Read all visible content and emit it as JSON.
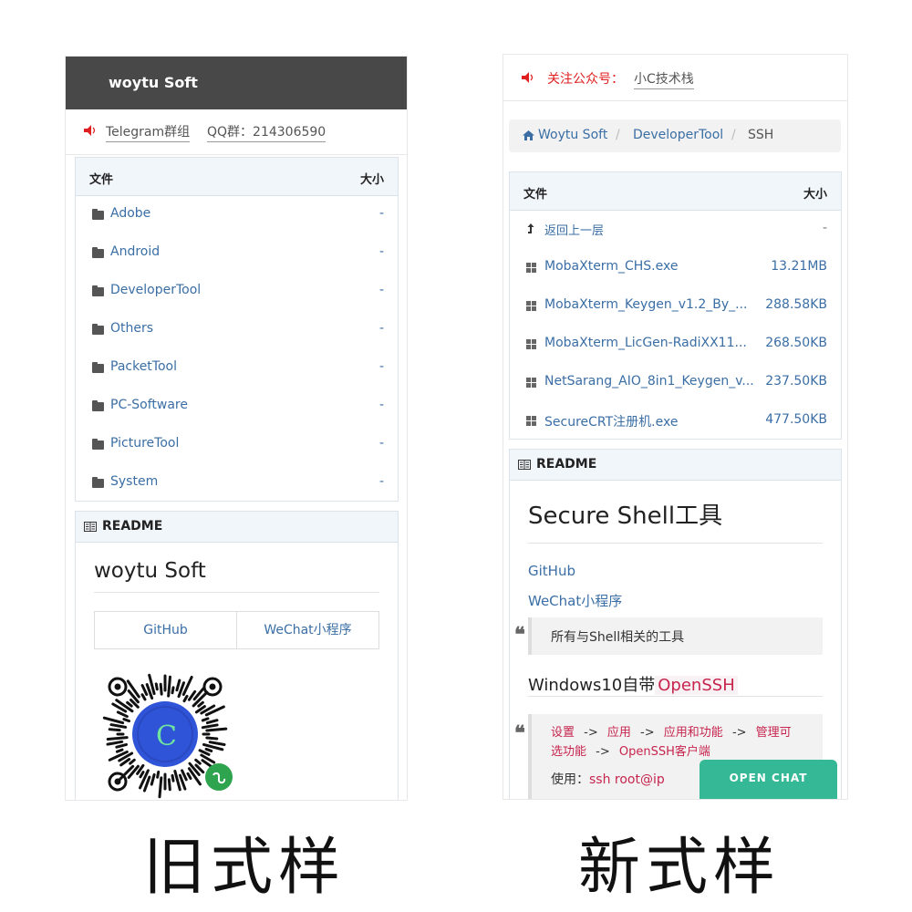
{
  "old_style": {
    "brand": "woytu Soft",
    "notice": {
      "telegram": "Telegram群组",
      "qq": "QQ群：214306590"
    },
    "table": {
      "col_file": "文件",
      "col_size": "大小",
      "rows": [
        {
          "name": "Adobe",
          "size": "-"
        },
        {
          "name": "Android",
          "size": "-"
        },
        {
          "name": "DeveloperTool",
          "size": "-"
        },
        {
          "name": "Others",
          "size": "-"
        },
        {
          "name": "PacketTool",
          "size": "-"
        },
        {
          "name": "PC-Software",
          "size": "-"
        },
        {
          "name": "PictureTool",
          "size": "-"
        },
        {
          "name": "System",
          "size": "-"
        }
      ]
    },
    "readme": {
      "label": "README",
      "title": "woytu Soft",
      "github": "GitHub",
      "wechat": "WeChat小程序",
      "qr_letter": "C"
    }
  },
  "new_style": {
    "notice": {
      "label": "关注公众号：",
      "account": "小C技术栈"
    },
    "breadcrumb": [
      "Woytu Soft",
      "DeveloperTool",
      "SSH"
    ],
    "table": {
      "col_file": "文件",
      "col_size": "大小",
      "back_row": {
        "name": "返回上一层",
        "size": "-"
      },
      "rows": [
        {
          "name": "MobaXterm_CHS.exe",
          "size": "13.21MB"
        },
        {
          "name": "MobaXterm_Keygen_v1.2_By_...",
          "size": "288.58KB"
        },
        {
          "name": "MobaXterm_LicGen-RadiXX11...",
          "size": "268.50KB"
        },
        {
          "name": "NetSarang_AIO_8in1_Keygen_v...",
          "size": "237.50KB"
        },
        {
          "name": "SecureCRT注册机.exe",
          "size": "477.50KB"
        }
      ]
    },
    "readme": {
      "label": "README",
      "title": "Secure Shell工具",
      "github": "GitHub",
      "wechat": "WeChat小程序",
      "quote1": "所有与Shell相关的工具",
      "section_prefix": "Windows10自带",
      "section_code": "OpenSSH",
      "path_1": "设置",
      "path_2": "应用",
      "path_3": "应用和功能",
      "path_4a": "管理可",
      "path_4b": "选功能",
      "path_5": "OpenSSH客户端",
      "arrow": "->",
      "use_label": "使用：",
      "use_code": "ssh root@ip"
    },
    "chat_button": "OPEN CHAT"
  },
  "captions": {
    "old": "旧式样",
    "new": "新式样"
  },
  "colors": {
    "accent": "#3a6ea5",
    "topbar": "#484848",
    "chat": "#35b895",
    "code": "#c7254e",
    "speaker": "#e02020"
  }
}
